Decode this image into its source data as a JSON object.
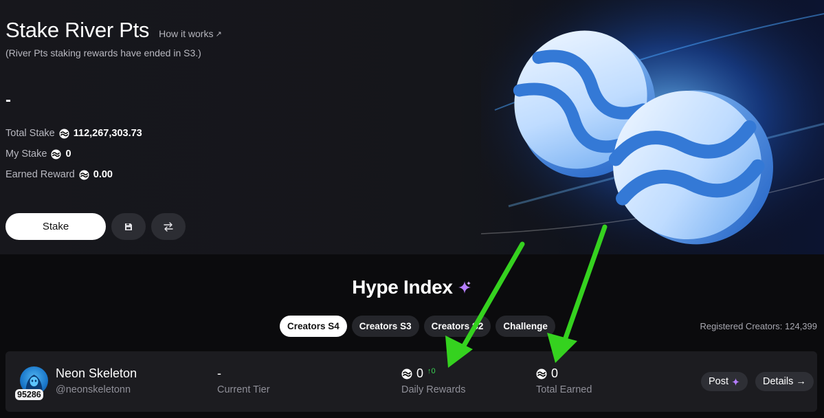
{
  "hero": {
    "title": "Stake River Pts",
    "how_it_works": "How it works",
    "how_it_works_arrow": "↗",
    "subtitle": "(River Pts staking rewards have ended in S3.)",
    "dash": "-",
    "stats": [
      {
        "label": "Total Stake",
        "value": "112,267,303.73"
      },
      {
        "label": "My Stake",
        "value": "0"
      },
      {
        "label": "Earned Reward",
        "value": "0.00"
      }
    ],
    "stake_button": "Stake",
    "icons": {
      "save": "save-icon",
      "swap": "swap-arrows-icon",
      "token": "river-token-icon"
    }
  },
  "hype": {
    "title": "Hype Index",
    "tabs": [
      {
        "label": "Creators S4",
        "active": true
      },
      {
        "label": "Creators S3",
        "active": false
      },
      {
        "label": "Creators S2",
        "active": false
      },
      {
        "label": "Challenge",
        "active": false
      }
    ],
    "registered_label": "Registered Creators: 124,399"
  },
  "creator": {
    "name": "Neon Skeleton",
    "handle": "@neonskeletonn",
    "rank": "95286",
    "tier_value": "-",
    "tier_label": "Current Tier",
    "daily_value": "0",
    "daily_delta": "↑0",
    "daily_label": "Daily Rewards",
    "earned_value": "0",
    "earned_label": "Total Earned",
    "post_label": "Post",
    "details_label": "Details",
    "details_arrow": "→"
  },
  "colors": {
    "accent_green": "#39d353",
    "arrow_green": "#35d21f",
    "sparkle_purple": "#b57dff",
    "coin_blue": "#3a8be8"
  }
}
